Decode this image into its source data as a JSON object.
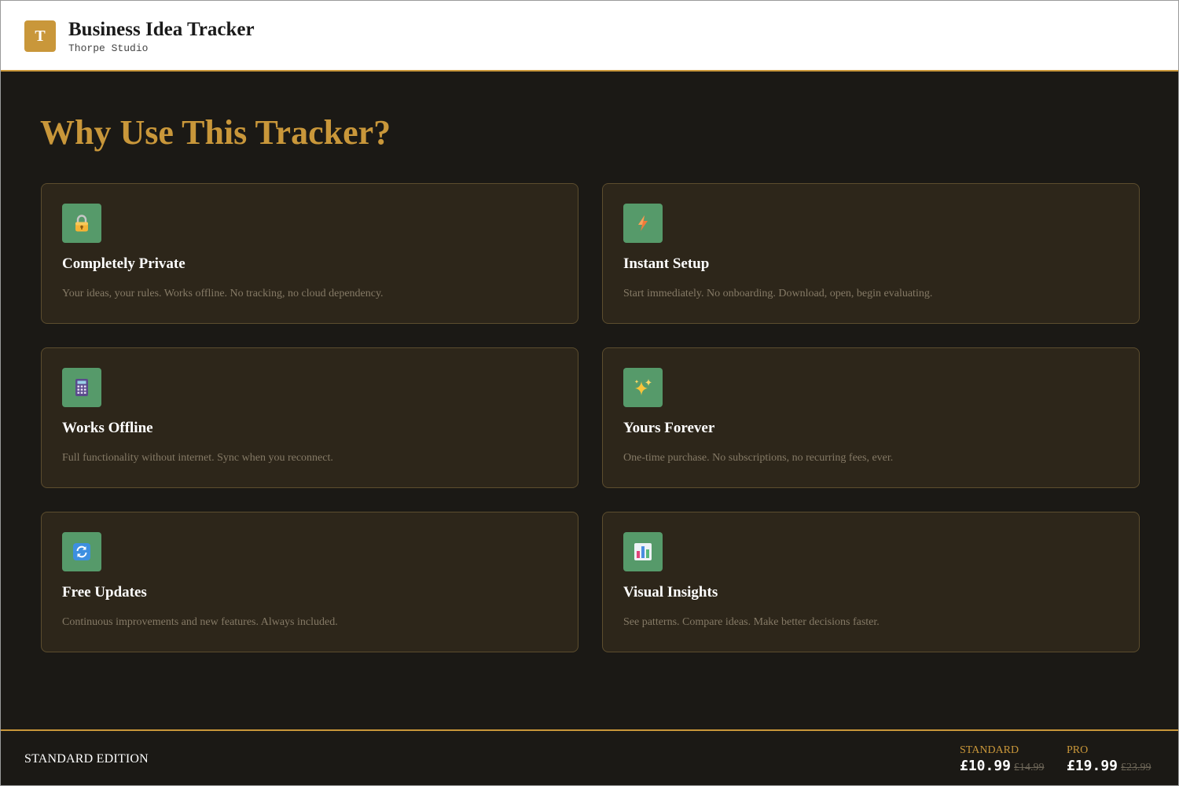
{
  "header": {
    "logo_letter": "T",
    "title": "Business Idea Tracker",
    "subtitle": "Thorpe Studio"
  },
  "main": {
    "heading": "Why Use This Tracker?",
    "features": [
      {
        "icon": "lock-icon",
        "title": "Completely Private",
        "description": "Your ideas, your rules. Works offline. No tracking, no cloud dependency."
      },
      {
        "icon": "lightning-icon",
        "title": "Instant Setup",
        "description": "Start immediately. No onboarding. Download, open, begin evaluating."
      },
      {
        "icon": "calculator-icon",
        "title": "Works Offline",
        "description": "Full functionality without internet. Sync when you reconnect."
      },
      {
        "icon": "sparkles-icon",
        "title": "Yours Forever",
        "description": "One-time purchase. No subscriptions, no recurring fees, ever."
      },
      {
        "icon": "refresh-icon",
        "title": "Free Updates",
        "description": "Continuous improvements and new features. Always included."
      },
      {
        "icon": "bar-chart-icon",
        "title": "Visual Insights",
        "description": "See patterns. Compare ideas. Make better decisions faster."
      }
    ]
  },
  "footer": {
    "edition": "STANDARD EDITION",
    "pricing": [
      {
        "label": "STANDARD",
        "price": "£10.99",
        "original": "£14.99"
      },
      {
        "label": "PRO",
        "price": "£19.99",
        "original": "£23.99"
      }
    ]
  },
  "colors": {
    "accent": "#c9973a",
    "background": "#1b1915",
    "card": "#2d261a",
    "icon_tile": "#569a6a"
  }
}
